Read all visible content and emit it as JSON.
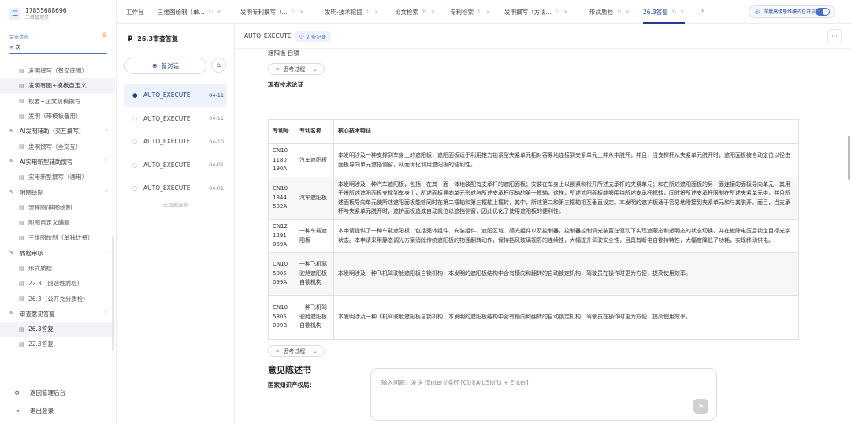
{
  "user": {
    "phone": "17855688696",
    "sub": "二级管理员"
  },
  "member": {
    "label": "会员状态",
    "value": "∞ 次"
  },
  "nav": [
    {
      "type": "item",
      "label": "发明撰写（有交底图）",
      "active": false
    },
    {
      "type": "item",
      "label": "发明有图+模板自定义",
      "active": true
    },
    {
      "type": "item",
      "label": "权要+正文初稿撰写",
      "active": false
    },
    {
      "type": "item",
      "label": "发明（带模板备用）",
      "active": false
    },
    {
      "type": "group",
      "label": "AI发明辅助（交互撰写）"
    },
    {
      "type": "item",
      "label": "发明撰写（全交互）",
      "active": false
    },
    {
      "type": "group",
      "label": "AI实用新型辅助撰写"
    },
    {
      "type": "item",
      "label": "实用新型撰写（通用）",
      "active": false
    },
    {
      "type": "group",
      "label": "附图绘制"
    },
    {
      "type": "item",
      "label": "流程图/框图绘制",
      "active": false
    },
    {
      "type": "item",
      "label": "附图自定义编辑",
      "active": false
    },
    {
      "type": "item",
      "label": "三维图绘制（单独计费）",
      "active": false
    },
    {
      "type": "group",
      "label": "质检审核"
    },
    {
      "type": "item",
      "label": "形式质检",
      "active": false
    },
    {
      "type": "item",
      "label": "22.3（创造性质检）",
      "active": false
    },
    {
      "type": "item",
      "label": "26.3（公开充分质检）",
      "active": false
    },
    {
      "type": "group",
      "label": "审查意见答复"
    },
    {
      "type": "item",
      "label": "26.3答复",
      "active": true
    },
    {
      "type": "item",
      "label": "22.3答复",
      "active": false
    }
  ],
  "footer": {
    "admin": "返回管理后台",
    "logout": "退出登录"
  },
  "tabs": [
    {
      "label": "工作台",
      "icons": false
    },
    {
      "label": "三维图绘制（单...",
      "icons": true
    },
    {
      "label": "发明专利撰写（...",
      "icons": true
    },
    {
      "label": "发明-技术挖掘",
      "icons": true
    },
    {
      "label": "论文检索",
      "icons": true
    },
    {
      "label": "专利检索",
      "icons": true
    },
    {
      "label": "发明撰写（方法...",
      "icons": true
    },
    {
      "label": "形式质检",
      "icons": true
    },
    {
      "label": "26.3答复",
      "icons": true
    }
  ],
  "toggle": {
    "label": "深度高级思维模式已开启",
    "on": true
  },
  "conv": {
    "title": "26.3审查答复",
    "new_chat": "新对话",
    "items": [
      {
        "label": "AUTO_EXECUTE",
        "date": "04-11",
        "active": true
      },
      {
        "label": "AUTO_EXECUTE",
        "date": "04-11",
        "active": false
      },
      {
        "label": "AUTO_EXECUTE",
        "date": "04-10",
        "active": false
      },
      {
        "label": "AUTO_EXECUTE",
        "date": "04-01",
        "active": false
      },
      {
        "label": "AUTO_EXECUTE",
        "date": "04-01",
        "active": false
      }
    ],
    "loaded_all": "已加载全部"
  },
  "main": {
    "title": "AUTO_EXECUTE",
    "badge": "2 条记录",
    "top_text": "遮阳板 自锁",
    "think_label": "思考过程",
    "section_label": "现有技术论证",
    "table_headers": [
      "专利号",
      "专利名称",
      "核心技术特征"
    ],
    "table_rows": [
      {
        "no": "CN10 1180 190A",
        "name": "汽车遮阳板",
        "feature": "本发明涉及一种支撑到车身上的遮阳板，遮阳面板适于利用推力锁紧型夹紧单元相对容易地连接到夹紧单元上并从中脱开。并且，当支撑杆从夹紧单元脱开时，遮阳面板被自动定位以径由面板导向单元遮挡侧窗，从而优化利用遮阳板的便利性。"
      },
      {
        "no": "CN10 1844 502A",
        "name": "汽车遮阳板",
        "feature": "本发明涉及一种汽车遮阳板，包括：在其一面一体地装配有支承杆的遮阳面板；安装在车身上以锁紧和松开所述支承杆的夹紧单元；和在所述遮阳面板的另一面连接的面板导向单元，其用于将所述遮阳面板支撑到车身上，所述面板导向单元形成与所述支承杆同轴的第一框轴，这样，所述遮阳面板能够围绕所述支承杆框转，同时将所述支承杆限制在所述夹紧单元中，并且所述面板导向单元使所述遮阳面板能够同时在第二框轴和第三框轴上框转，其中，所述第二和第三框轴相互垂直设定。本发明的遮护板适于容易地附接到夹紧单元和与其脱开。而且，当支承杆与夹紧单元脱开时，遮护面板造成自动就位以遮挡侧窗，因此优化了使用遮阳板的便利性。"
      },
      {
        "no": "CN12 1291 069A",
        "name": "一种车载遮阳板",
        "feature": "本申请提供了一种车载遮阳板，包括壳体组件、安装组件、遮阳区域、感光组件以及控制器，控制器控制调光装置在驱动下实现遮蔽态和透明态的状态切换，并在撤除电压后锁定目标光学状态。本申请采用静态调光方案消除传统遮阳板的物理翻转动作，保持挡风玻璃视野的连续性，大幅提升驾驶安全性，且具有断电自锁持特性，大幅度降低了功耗，实现移动供电。"
      },
      {
        "no": "CN10 5805 099A",
        "name": "一种飞机驾驶舱遮阳板自锁机构",
        "feature": "本发明涉及一种飞机驾驶舱遮阳板自锁机构，本发明的遮阳板结构中含有横向和翻转的自动锁定机构，驾驶员在操作时更为方便，提高使用效率。"
      },
      {
        "no": "CN10 5805 099B",
        "name": "一种飞机驾驶舱遮阳板自锁机构",
        "feature": "本发明涉及一种飞机驾驶舱遮阳板自锁机构，本发明的遮阳板结构中含有横向和翻转的自动锁定机构，驾驶员在操作时更为方便，提高使用效率。"
      }
    ],
    "opinion_heading": "意见陈述书",
    "office_label": "国家知识产权局："
  },
  "input": {
    "placeholder": "输入问题，发送 [Enter]/换行 [Ctrl(Alt/Shift) + Enter]"
  },
  "colors": {
    "accent": "#1d3f8f",
    "accent_light": "#4a72c9",
    "active_bg": "#eef2fb"
  }
}
